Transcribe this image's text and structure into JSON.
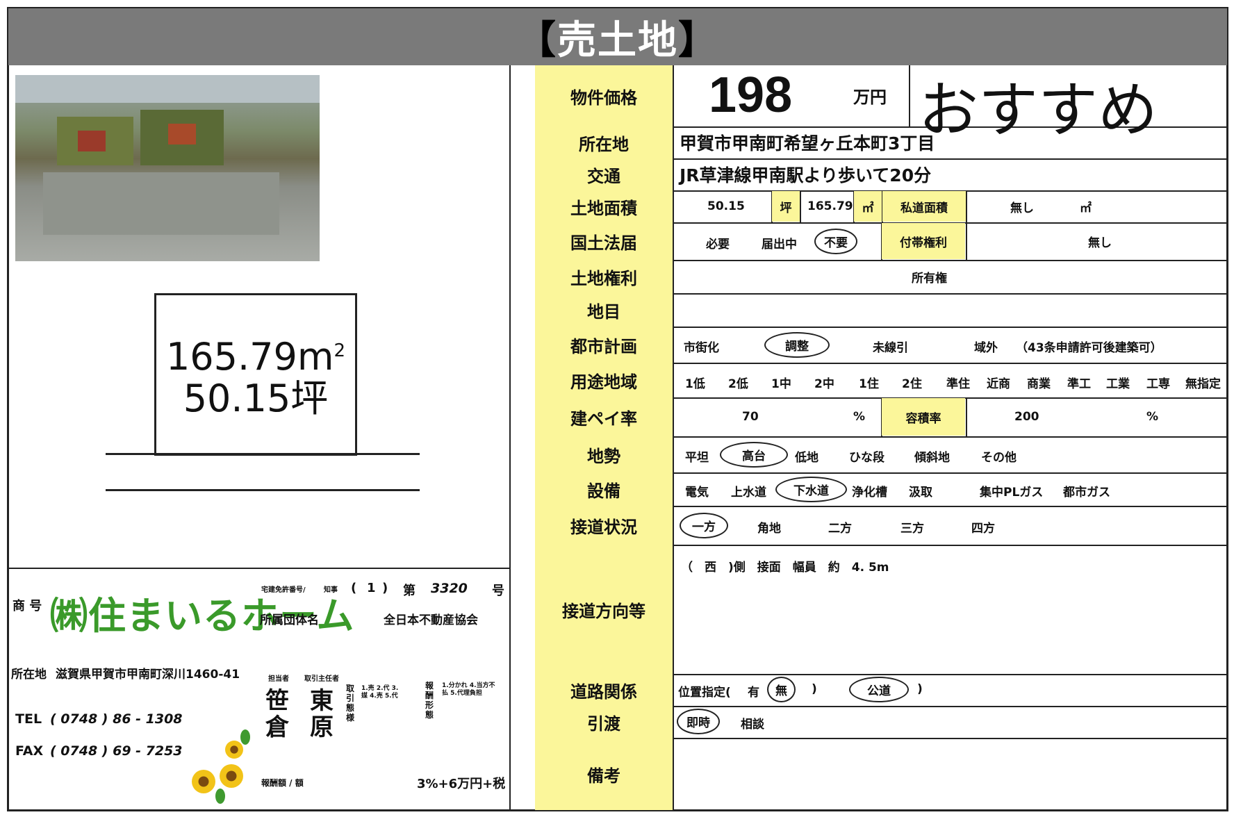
{
  "header": {
    "title": "売土地",
    "bracket_open": "【",
    "bracket_close": "】"
  },
  "area_display": {
    "sqm": "165.79m",
    "sqm_sup": "2",
    "tsubo": "50.15坪"
  },
  "colors": {
    "label_bg": "#fbf69a",
    "header_bg": "#7a7a7a",
    "logo_green": "#3a9a2a"
  },
  "price": {
    "label": "物件価格",
    "value": "198",
    "unit": "万円",
    "tagline": "おすすめ"
  },
  "location": {
    "label": "所在地",
    "value": "甲賀市甲南町希望ヶ丘本町3丁目"
  },
  "transport": {
    "label": "交通",
    "value": "JR草津線甲南駅より歩いて20分"
  },
  "land_area": {
    "label": "土地面積",
    "tsubo": "50.15",
    "tsubo_unit": "坪",
    "sqm": "165.79",
    "sqm_unit": "㎡",
    "private_road_label": "私道面積",
    "private_road_value": "無し",
    "private_road_unit": "㎡"
  },
  "kokudo": {
    "label": "国土法届",
    "opts": [
      "必要",
      "届出中",
      "不要"
    ],
    "selected": "不要",
    "rights_label": "付帯権利",
    "rights_value": "無し"
  },
  "land_rights": {
    "label": "土地権利",
    "value": "所有権"
  },
  "chimoku": {
    "label": "地目",
    "value": ""
  },
  "city_planning": {
    "label": "都市計画",
    "opts": [
      "市街化",
      "調整",
      "未線引",
      "域外"
    ],
    "selected": "調整",
    "note": "（43条申請許可後建築可）"
  },
  "zoning": {
    "label": "用途地域",
    "opts": [
      "1低",
      "2低",
      "1中",
      "2中",
      "1住",
      "2住",
      "準住",
      "近商",
      "商業",
      "準工",
      "工業",
      "工専",
      "無指定"
    ]
  },
  "coverage": {
    "label": "建ペイ率",
    "value": "70",
    "unit": "%",
    "far_label": "容積率",
    "far_value": "200",
    "far_unit": "%"
  },
  "terrain": {
    "label": "地勢",
    "opts": [
      "平坦",
      "高台",
      "低地",
      "ひな段",
      "傾斜地",
      "その他"
    ],
    "selected": "高台"
  },
  "facilities": {
    "label": "設備",
    "opts": [
      "電気",
      "上水道",
      "下水道",
      "浄化槽",
      "汲取",
      "集中PLガス",
      "都市ガス"
    ],
    "selected": "下水道"
  },
  "road_access": {
    "label": "接道状況",
    "opts": [
      "一方",
      "角地",
      "二方",
      "三方",
      "四方"
    ],
    "selected": "一方"
  },
  "road_direction": {
    "label": "接道方向等",
    "value": "（　西　)側　接面　幅員　約　4. 5m"
  },
  "road_relation": {
    "label": "道路関係",
    "prefix": "位置指定(",
    "opt_yes": "有",
    "opt_no": "無",
    "close1": ")",
    "public": "公道",
    "close2": ")"
  },
  "handover": {
    "label": "引渡",
    "opts": [
      "即時",
      "相談"
    ],
    "selected": "即時"
  },
  "remarks": {
    "label": "備考",
    "value": ""
  },
  "company": {
    "trade_label": "商 号",
    "name": "㈱住まいるホーム",
    "license_label": "宅建免許番号/",
    "license_kind": "知事",
    "license_paren_open": "(",
    "license_num": "1",
    "license_paren_close": ")",
    "license_dai": "第",
    "license_no": "3320",
    "license_go": "号",
    "assoc_label": "所属団体名",
    "assoc": "全日本不動産協会",
    "address_label": "所在地",
    "address": "滋賀県甲賀市甲南町深川1460-41",
    "tel_label": "TEL",
    "tel": "( 0748 ) 86 - 1308",
    "fax_label": "FAX",
    "fax": "( 0748 ) 69 - 7253",
    "staff_label": "担当者",
    "manager_label": "取引主任者",
    "staff_name": "笹倉",
    "manager_name": "東原",
    "fee_label": "報酬額 / 額",
    "fee": "3%+6万円+税",
    "deal_label": "取引態様",
    "deal_opts": "1.売 2.代 3.媒 4.売 5.代",
    "fee_form_label": "報酬形態",
    "fee_form": "1.分かれ 4.当方不払 5.代理負担"
  }
}
